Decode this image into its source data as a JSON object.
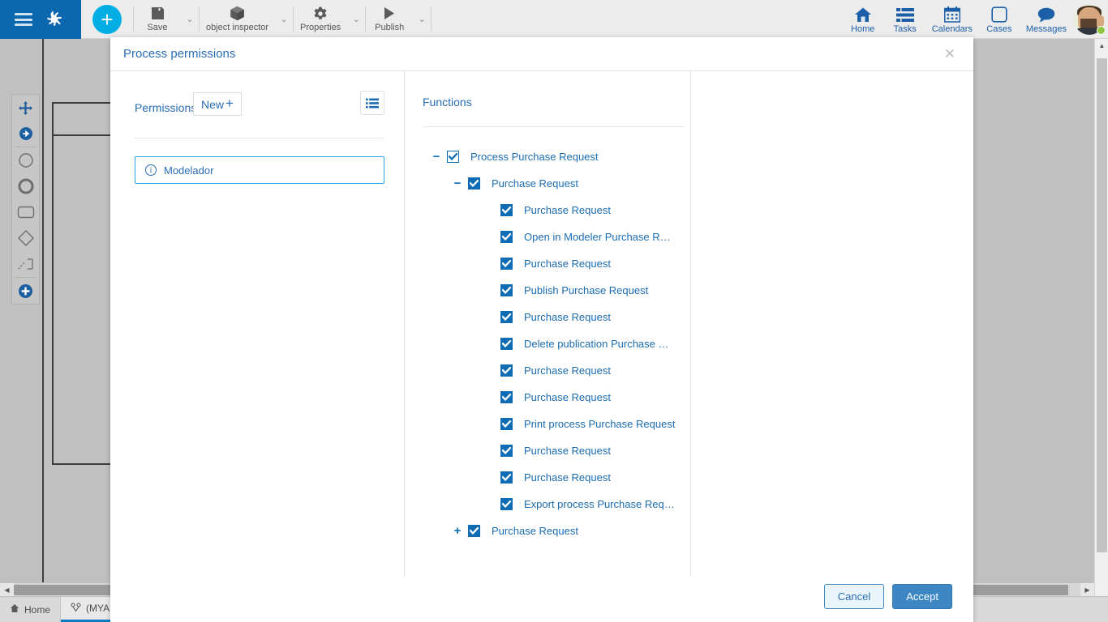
{
  "ribbon": {
    "menu_icon": "hamburger-icon",
    "logo_icon": "bizagi-logo-icon",
    "add_label": "+",
    "tools": [
      {
        "label": "Save",
        "icon": "save-icon"
      },
      {
        "label": "object inspector",
        "icon": "cube-icon"
      },
      {
        "label": "Properties",
        "icon": "gear-icon"
      },
      {
        "label": "Publish",
        "icon": "play-icon"
      }
    ],
    "caret": "⌄",
    "nav": [
      {
        "label": "Home",
        "icon": "home-icon"
      },
      {
        "label": "Tasks",
        "icon": "tasks-icon"
      },
      {
        "label": "Calendars",
        "icon": "calendar-icon"
      },
      {
        "label": "Cases",
        "icon": "cases-icon"
      },
      {
        "label": "Messages",
        "icon": "messages-icon"
      }
    ],
    "avatar_name": "user-avatar"
  },
  "palette": {
    "items": [
      "move-tool-icon",
      "sequence-flow-icon",
      "start-event-icon",
      "intermediate-event-icon",
      "task-icon",
      "gateway-icon",
      "connector-icon",
      "add-element-icon"
    ]
  },
  "taskbar": {
    "tabs": [
      {
        "label": "Home",
        "icon": "home-icon",
        "active": false
      },
      {
        "label": "(MYAPP) P",
        "icon": "process-icon",
        "active": true
      }
    ]
  },
  "modal": {
    "title": "Process permissions",
    "close_label": "✕",
    "permissions": {
      "label": "Permissions",
      "new_button": "New",
      "new_plus": "+",
      "list_toggle_icon": "list-view-icon",
      "items": [
        {
          "name": "Modelador",
          "icon": "info-icon",
          "selected": true
        }
      ]
    },
    "functions": {
      "title": "Functions",
      "tree": [
        {
          "level": 0,
          "expander": "−",
          "checked": true,
          "style": "light",
          "label": "Process Purchase Request"
        },
        {
          "level": 1,
          "expander": "−",
          "checked": true,
          "style": "solid",
          "label": "Purchase Request"
        },
        {
          "level": 2,
          "expander": "",
          "checked": true,
          "style": "solid",
          "label": "Purchase Request"
        },
        {
          "level": 2,
          "expander": "",
          "checked": true,
          "style": "solid",
          "label": "Open in Modeler Purchase R…"
        },
        {
          "level": 2,
          "expander": "",
          "checked": true,
          "style": "solid",
          "label": "Purchase Request"
        },
        {
          "level": 2,
          "expander": "",
          "checked": true,
          "style": "solid",
          "label": "Publish Purchase Request"
        },
        {
          "level": 2,
          "expander": "",
          "checked": true,
          "style": "solid",
          "label": "Purchase Request"
        },
        {
          "level": 2,
          "expander": "",
          "checked": true,
          "style": "solid",
          "label": "Delete publication Purchase …"
        },
        {
          "level": 2,
          "expander": "",
          "checked": true,
          "style": "solid",
          "label": "Purchase Request"
        },
        {
          "level": 2,
          "expander": "",
          "checked": true,
          "style": "solid",
          "label": "Purchase Request"
        },
        {
          "level": 2,
          "expander": "",
          "checked": true,
          "style": "solid",
          "label": "Print process Purchase Request"
        },
        {
          "level": 2,
          "expander": "",
          "checked": true,
          "style": "solid",
          "label": "Purchase Request"
        },
        {
          "level": 2,
          "expander": "",
          "checked": true,
          "style": "solid",
          "label": "Purchase Request"
        },
        {
          "level": 2,
          "expander": "",
          "checked": true,
          "style": "solid",
          "label": "Export process Purchase Req…"
        },
        {
          "level": 1,
          "expander": "+",
          "checked": true,
          "style": "solid",
          "label": "Purchase Request"
        }
      ]
    },
    "footer": {
      "cancel": "Cancel",
      "accept": "Accept"
    }
  },
  "colors": {
    "brand_blue": "#0b67ae",
    "accent_cyan": "#00aee6",
    "link_blue": "#2a6db5",
    "tree_blue": "#0d6cb3",
    "accept_button": "#3c87c4",
    "status_green": "#8dc63f"
  }
}
